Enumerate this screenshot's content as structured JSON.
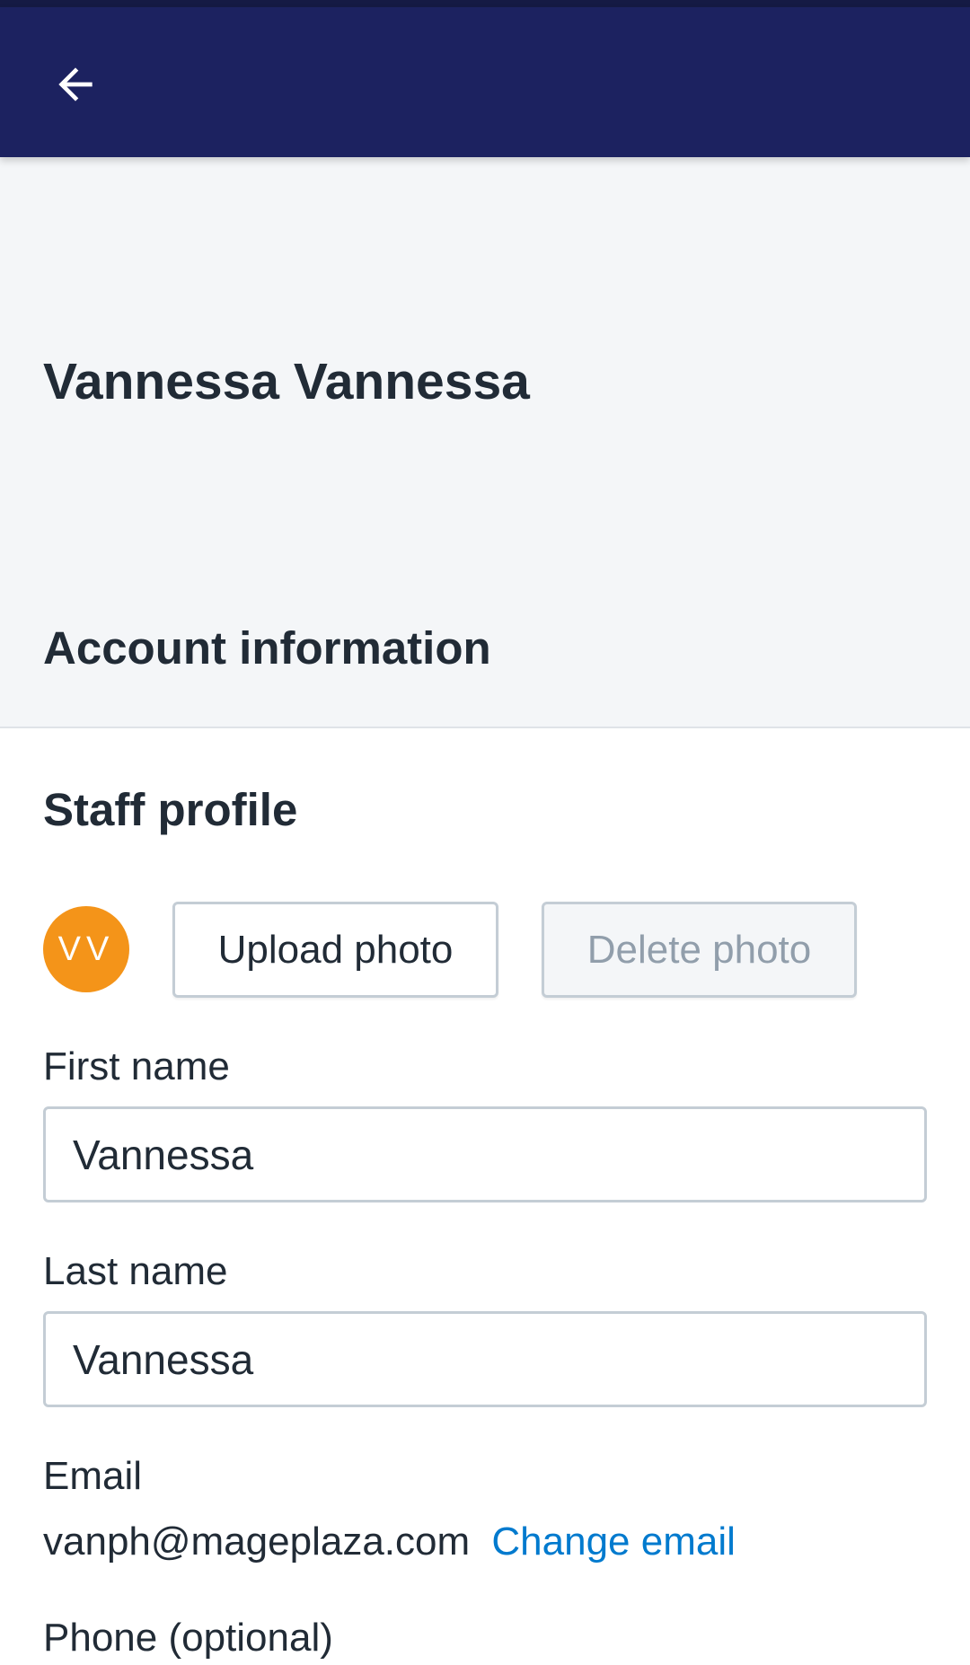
{
  "app_bar": {
    "back_icon": "arrow-left-icon",
    "background": "#1c2260"
  },
  "header": {
    "title": "Vannessa Vannessa",
    "section_title": "Account information"
  },
  "staff_profile": {
    "title": "Staff profile",
    "avatar": {
      "initials": "VV",
      "color": "#f49419"
    },
    "upload_label": "Upload photo",
    "delete_label": "Delete photo",
    "first_name": {
      "label": "First name",
      "value": "Vannessa"
    },
    "last_name": {
      "label": "Last name",
      "value": "Vannessa"
    },
    "email": {
      "label": "Email",
      "value": "vanph@mageplaza.com",
      "change_label": "Change email"
    },
    "phone": {
      "label": "Phone (optional)"
    }
  },
  "colors": {
    "accent_link": "#007ace",
    "page_background": "#f4f6f8",
    "text": "#212b36"
  }
}
